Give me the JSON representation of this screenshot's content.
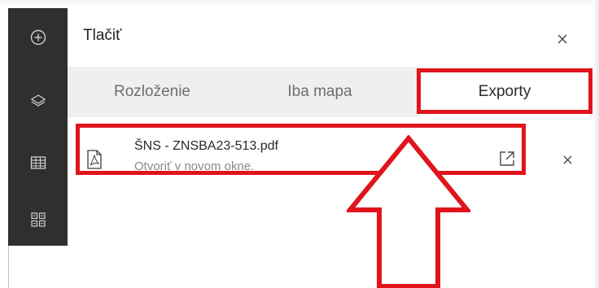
{
  "sidebar": {
    "items": [
      {
        "icon": "add-circle-icon",
        "label": ""
      },
      {
        "icon": "layers-icon",
        "label": ""
      },
      {
        "icon": "table-icon",
        "label": ""
      },
      {
        "icon": "grid-apps-icon",
        "label": ""
      }
    ]
  },
  "panel": {
    "title": "Tlačiť",
    "close_icon": "close-icon"
  },
  "tabs": [
    {
      "label": "Rozloženie",
      "selected": false
    },
    {
      "label": "Iba mapa",
      "selected": false
    },
    {
      "label": "Exporty",
      "selected": true
    }
  ],
  "export": {
    "file_name": "ŠNS - ZNSBA23-513.pdf",
    "subtitle": "Otvoriť v novom okne.",
    "file_icon": "pdf-file-icon",
    "open_icon": "open-external-icon",
    "remove_icon": "close-icon"
  },
  "colors": {
    "sidebar_bg": "#2f2f2f",
    "tabs_bg": "#efefef",
    "highlight": "#e0141c"
  }
}
